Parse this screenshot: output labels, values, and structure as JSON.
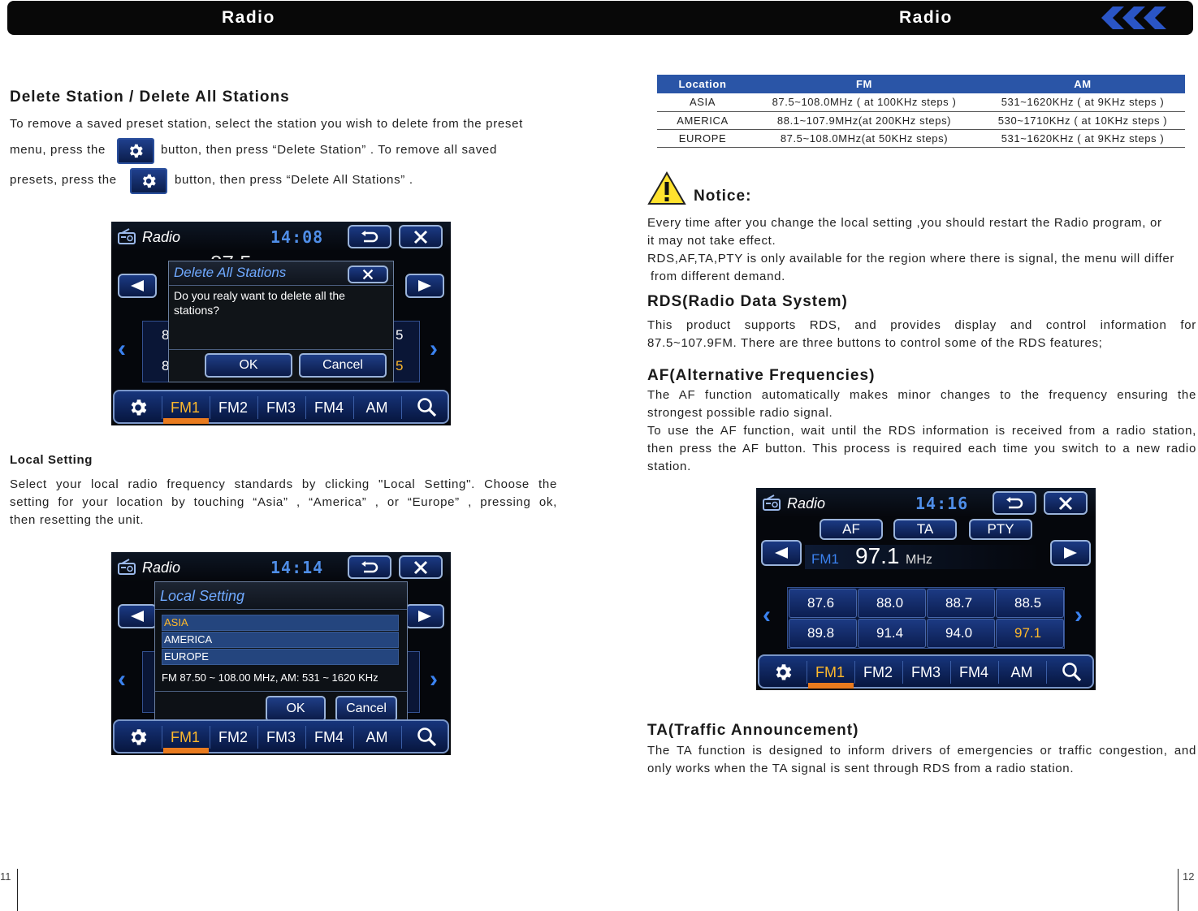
{
  "header": {
    "left_title": "Radio",
    "right_title": "Radio"
  },
  "left": {
    "delete_heading": "Delete Station / Delete All Stations",
    "delete_line1": "To remove a saved preset station, select the station you wish to delete from the preset",
    "delete_line2a": "menu, press the",
    "delete_line2b": "button, then press “Delete Station” . To remove all saved",
    "delete_line3a": "presets, press the",
    "delete_line3b": "button, then press “Delete All Stations” .",
    "local_heading": "Local Setting",
    "local_line1": "Select your local radio frequency standards by clicking \"Local Setting\". Choose the",
    "local_line2": "setting for your location by touching “Asia” , “America” , or “Europe” , pressing ok,",
    "local_line3": "then resetting the unit."
  },
  "screen1": {
    "title": "Radio",
    "clock": "14:08",
    "partial_freq": "87.5",
    "dialog_title": "Delete All Stations",
    "dialog_text_1": "Do you realy want to delete all the",
    "dialog_text_2": "stations?",
    "ok": "OK",
    "cancel": "Cancel",
    "edge_left": [
      "8",
      "8"
    ],
    "edge_right": [
      "5",
      "5"
    ],
    "tabs": [
      "FM1",
      "FM2",
      "FM3",
      "FM4",
      "AM"
    ]
  },
  "screen2": {
    "title": "Radio",
    "clock": "14:14",
    "dialog_title": "Local Setting",
    "options": [
      "ASIA",
      "AMERICA",
      "EUROPE"
    ],
    "range": "FM 87.50 ~ 108.00 MHz, AM: 531 ~ 1620 KHz",
    "ok": "OK",
    "cancel": "Cancel",
    "tabs": [
      "FM1",
      "FM2",
      "FM3",
      "FM4",
      "AM"
    ]
  },
  "table": {
    "headers": [
      "Location",
      "FM",
      "AM"
    ],
    "rows": [
      [
        "ASIA",
        "87.5~108.0MHz ( at 100KHz steps )",
        "531~1620KHz ( at 9KHz steps )"
      ],
      [
        "AMERICA",
        "88.1~107.9MHz(at 200KHz steps)",
        "530~1710KHz ( at 10KHz steps )"
      ],
      [
        "EUROPE",
        "87.5~108.0MHz(at 50KHz steps)",
        "531~1620KHz ( at 9KHz steps )"
      ]
    ]
  },
  "right": {
    "notice_heading": "Notice:",
    "notice_1": "Every time after you change the local setting ,you should restart the Radio program, or",
    "notice_2": "it may not take effect.",
    "notice_3": "RDS,AF,TA,PTY is only available for the region where there is signal, the menu  will differ",
    "notice_4": "from different demand.",
    "rds_heading": "RDS(Radio Data System)",
    "rds_1": "This product supports RDS, and provides display and control information for",
    "rds_2": "87.5~107.9FM. There are three buttons to control some of the RDS features;",
    "af_heading": "AF(Alternative Frequencies)",
    "af_1": "The AF function automatically makes minor changes to the frequency ensuring the",
    "af_2": "strongest possible radio signal.",
    "af_3": "To use the AF function, wait until the RDS information is received from a radio station,",
    "af_4": "then press the AF button. This process is required each time you switch to a new radio",
    "af_5": "station.",
    "ta_heading": "TA(Traffic Announcement)",
    "ta_1": "The TA function is designed to inform drivers of emergencies or traffic congestion, and",
    "ta_2": "only works when the TA signal is sent through RDS from a radio station."
  },
  "screen3": {
    "title": "Radio",
    "clock": "14:16",
    "rds_buttons": [
      "AF",
      "TA",
      "PTY"
    ],
    "band": "FM1",
    "freq": "97.1",
    "unit": "MHz",
    "presets": [
      "87.6",
      "88.0",
      "88.7",
      "88.5",
      "89.8",
      "91.4",
      "94.0",
      "97.1"
    ],
    "tabs": [
      "FM1",
      "FM2",
      "FM3",
      "FM4",
      "AM"
    ]
  },
  "pages": {
    "left": "11",
    "right": "12"
  },
  "colors": {
    "accent_blue": "#2a55a7",
    "active_tab": "#ffb92b",
    "clock": "#4f8ee8"
  }
}
